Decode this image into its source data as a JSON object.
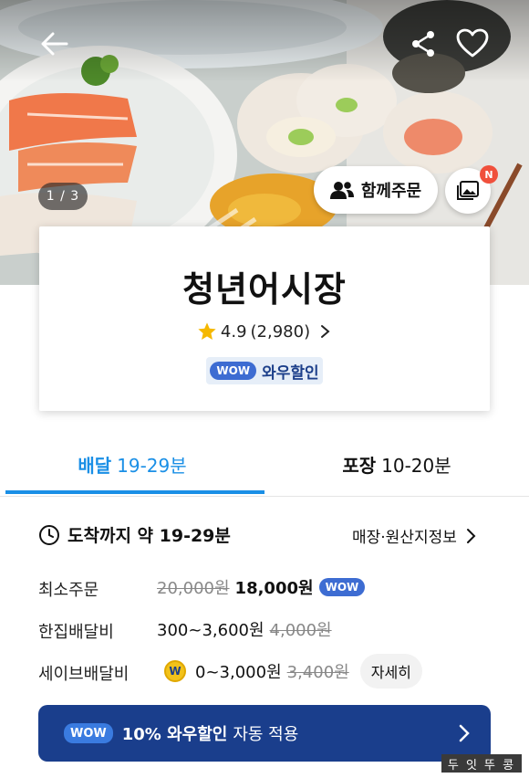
{
  "hero": {
    "image_counter": "1 / 3",
    "group_order_label": "함께주문",
    "new_badge": "N"
  },
  "store": {
    "name": "청년어시장",
    "rating": "4.9",
    "review_count": "(2,980)",
    "wow_chip": "WOW",
    "wow_label": "와우할인"
  },
  "tabs": [
    {
      "label": "배달",
      "time": "19-29분",
      "selected": true
    },
    {
      "label": "포장",
      "time": "10-20분",
      "selected": false
    }
  ],
  "delivery_info": {
    "eta_label": "도착까지 약 19-29분",
    "origin_link": "매장·원산지정보",
    "min_order": {
      "label": "최소주문",
      "original_price": "20,000원",
      "price": "18,000원",
      "chip": "WOW"
    },
    "single_fee": {
      "label": "한집배달비",
      "range": "300~3,600원",
      "original": "4,000원"
    },
    "save_fee": {
      "label": "세이브배달비",
      "coin": "W",
      "range": "0~3,000원",
      "original": "3,400원",
      "detail_button": "자세히"
    }
  },
  "banner": {
    "chip": "WOW",
    "text_bold": "10% 와우할인",
    "text_light": "자동 적용"
  },
  "watermark": "두 잇 뚜 콩",
  "colors": {
    "accent_blue": "#1a8fe6",
    "wow_navy": "#1a3e8c",
    "wow_chip": "#3d6cd2",
    "star": "#f5b800",
    "badge_red": "#f0503c"
  }
}
